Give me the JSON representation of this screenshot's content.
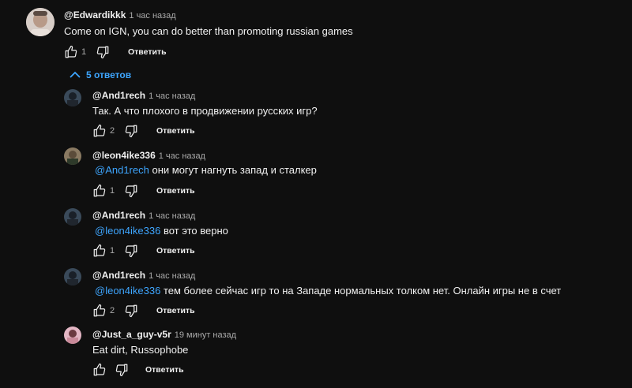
{
  "root": {
    "author": "@Edwardikkk",
    "time": "1 час назад",
    "text": "Come on IGN, you can do better than promoting russian games",
    "likes": "1",
    "reply_label": "Ответить"
  },
  "replies_toggle": "5 ответов",
  "replies": [
    {
      "author": "@And1rech",
      "time": "1 час назад",
      "mention": "",
      "text": "Так. А что плохого в продвижении русских игр?",
      "likes": "2",
      "reply_label": "Ответить"
    },
    {
      "author": "@leon4ike336",
      "time": "1 час назад",
      "mention": "@And1rech",
      "text": "они могут нагнуть запад и сталкер",
      "likes": "1",
      "reply_label": "Ответить"
    },
    {
      "author": "@And1rech",
      "time": "1 час назад",
      "mention": "@leon4ike336",
      "text": "вот это верно",
      "likes": "1",
      "reply_label": "Ответить"
    },
    {
      "author": "@And1rech",
      "time": "1 час назад",
      "mention": "@leon4ike336",
      "text": "тем более сейчас игр то на Западе нормальных толком нет. Онлайн игры не в счет",
      "likes": "2",
      "reply_label": "Ответить"
    },
    {
      "author": "@Just_a_guy-v5r",
      "time": "19 минут назад",
      "mention": "",
      "text": "Eat dirt, Russophobe",
      "likes": "",
      "reply_label": "Ответить"
    }
  ],
  "colors": {
    "background": "#0f0f0f",
    "text": "#f1f1f1",
    "meta": "#aaaaaa",
    "link": "#3ea6ff"
  }
}
